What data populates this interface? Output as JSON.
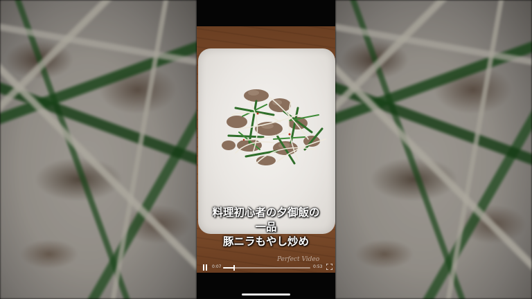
{
  "caption": {
    "line1": "料理初心者の夕御飯の",
    "line2": "一品",
    "line3": "豚ニラもやし炒め"
  },
  "player": {
    "current_time": "0:07",
    "total_time": "0:53",
    "progress_fraction": 0.13,
    "watermark": "Perfect Video",
    "state": "playing"
  },
  "colors": {
    "accent": "#ffffff",
    "background": "#000000"
  },
  "icons": {
    "pause": "pause-icon",
    "fullscreen": "fullscreen-icon"
  }
}
